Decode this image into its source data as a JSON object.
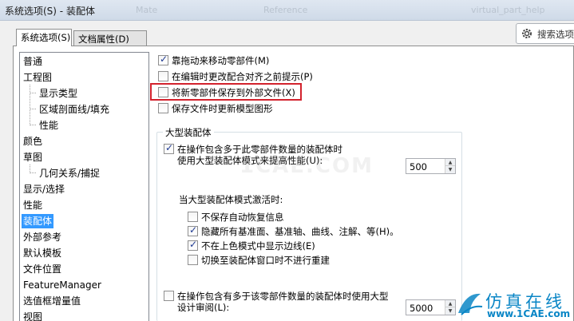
{
  "window": {
    "title": "系统选项(S) - 装配体",
    "ghost_texts": [
      "Mate",
      "Reference",
      "virtual_part_help"
    ]
  },
  "tabs": [
    {
      "label": "系统选项(S)",
      "active": true
    },
    {
      "label": "文档属性(D)",
      "active": false
    }
  ],
  "search": {
    "label": "搜索选项"
  },
  "tree": {
    "items": [
      {
        "label": "普通"
      },
      {
        "label": "工程图"
      },
      {
        "label": "显示类型"
      },
      {
        "label": "区域剖面线/填充"
      },
      {
        "label": "性能"
      },
      {
        "label": "颜色"
      },
      {
        "label": "草图"
      },
      {
        "label": "几何关系/捕捉"
      },
      {
        "label": "显示/选择"
      },
      {
        "label": "性能"
      },
      {
        "label": "装配体",
        "selected": true
      },
      {
        "label": "外部参考"
      },
      {
        "label": "默认模板"
      },
      {
        "label": "文件位置"
      },
      {
        "label": "FeatureManager"
      },
      {
        "label": "选值框增量值"
      },
      {
        "label": "视图"
      }
    ]
  },
  "options": {
    "drag_move": {
      "label": "靠拖动来移动零部件(M)",
      "checked": true
    },
    "prompt_edit": {
      "label": "在编辑时更改配合对齐之前提示(P)",
      "checked": false
    },
    "save_external": {
      "label": "将新零部件保存到外部文件(X)",
      "checked": false
    },
    "update_model": {
      "label": "保存文件时更新模型图形",
      "checked": false
    }
  },
  "large_assembly": {
    "group_title": "大型装配体",
    "use_large_mode": {
      "label_line1": "在操作包含多于此零部件数量的装配体时",
      "label_line2": "使用大型装配体模式来提高性能(U):",
      "checked": true,
      "value": "500"
    },
    "when_active_label": "当大型装配体模式激活时:",
    "sub_options": [
      {
        "label": "不保存自动恢复信息",
        "checked": false
      },
      {
        "label": "隐藏所有基准面、基准轴、曲线、注解、等(H)。",
        "checked": true
      },
      {
        "label": "不在上色模式中显示边线(E)",
        "checked": true
      },
      {
        "label": "切换至装配体窗口时不进行重建",
        "checked": false
      }
    ],
    "design_review": {
      "label_line1": "在操作包含有多于该零部件数量的装配体时使用大型",
      "label_line2": "设计审阅(L):",
      "checked": false,
      "value": "5000"
    }
  },
  "watermark": {
    "cn": "仿真在线",
    "url": "www.1CAE.com"
  },
  "colors": {
    "selection": "#3399ff",
    "highlight_box": "#d2222d",
    "watermark": "#0a86c6"
  }
}
